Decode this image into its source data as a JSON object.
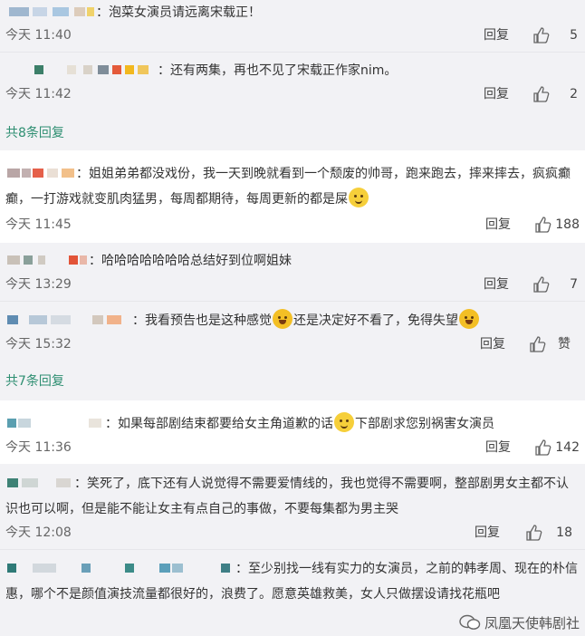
{
  "reply_label": "回复",
  "colors": {
    "accent_link": "#2f8f72",
    "panel_bg": "#f2f2f5"
  },
  "comments": [
    {
      "text": "泡菜女演员请远离宋载正！",
      "time": "今天 11:40",
      "likes": "5"
    },
    {
      "text": "还有两集，再也不见了宋载正作家nim。",
      "time": "今天 11:42",
      "likes": "2"
    },
    {
      "text": "姐姐弟弟都没戏份，我一天到晚就看到一个颓废的帅哥，跑来跑去，摔来摔去，疯疯癫癫，一打游戏就变肌肉猛男，每周都期待，每周更新的都是屎",
      "time": "今天 11:45",
      "likes": "188"
    },
    {
      "text": "哈哈哈哈哈哈哈总结好到位啊姐妹",
      "time": "今天 13:29",
      "likes": "7"
    },
    {
      "text_a": "我看预告也是这种感觉",
      "text_b": "还是决定好不看了，免得失望",
      "time": "今天 15:32",
      "likes": "赞"
    },
    {
      "text_a": "如果每部剧结束都要给女主角道歉的话",
      "text_b": "下部剧求您别祸害女演员",
      "time": "今天 11:36",
      "likes": "142"
    },
    {
      "text": "笑死了，底下还有人说觉得不需要爱情线的，我也觉得不需要啊，整部剧男女主都不认识也可以啊，但是能不能让女主有点自己的事做，不要每集都为男主哭",
      "time": "今天 12:08",
      "likes": "18"
    },
    {
      "text": "至少别找一线有实力的女演员，之前的韩孝周、现在的朴信惠，哪个不是颜值演技流量都很好的，浪费了。愿意英雄救美，女人只做摆设请找花瓶吧"
    }
  ],
  "more_replies": [
    "共8条回复",
    "共7条回复"
  ],
  "watermark": "凤凰天使韩剧社"
}
